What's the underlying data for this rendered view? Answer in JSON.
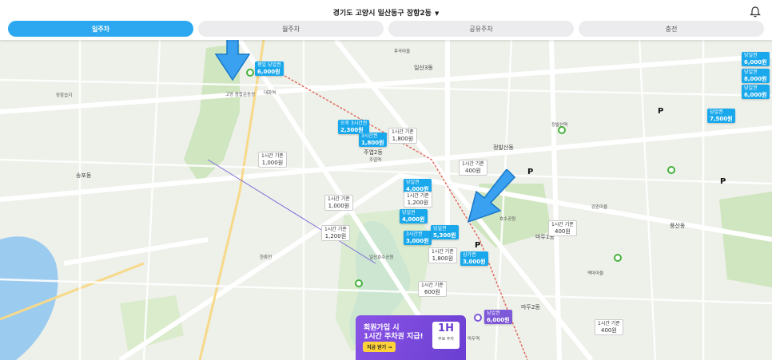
{
  "header": {
    "location": "경기도 고양시 일산동구 장항2동",
    "caret": "▼"
  },
  "tabs": [
    {
      "label": "일주차",
      "active": true
    },
    {
      "label": "월주차",
      "active": false
    },
    {
      "label": "공유주차",
      "active": false
    },
    {
      "label": "충전",
      "active": false
    }
  ],
  "price_labels": [
    {
      "title": "평일 당일권",
      "price": "6,000원"
    },
    {
      "title": "오후 3시간권",
      "price": "2,300원"
    },
    {
      "title": "3시간권",
      "price": "1,800원"
    },
    {
      "title": "당일권",
      "price": "4,000원"
    },
    {
      "title": "당일권",
      "price": "4,000원"
    },
    {
      "title": "3시간권",
      "price": "3,000원"
    },
    {
      "title": "당일권",
      "price": "5,300원"
    },
    {
      "title": "상가권",
      "price": "3,000원"
    },
    {
      "title": "당일권",
      "price": "7,500원"
    },
    {
      "title": "당일권",
      "price": "6,000원"
    },
    {
      "title": "당일권",
      "price": "8,000원"
    },
    {
      "title": "당일권",
      "price": "6,000원"
    }
  ],
  "time_labels": [
    {
      "title": "1시간 기준",
      "price": "1,000원"
    },
    {
      "title": "1시간 기준",
      "price": "1,800원"
    },
    {
      "title": "1시간 기준",
      "price": "400원"
    },
    {
      "title": "1시간 기준",
      "price": "1,000원"
    },
    {
      "title": "1시간 기준",
      "price": "1,200원"
    },
    {
      "title": "1시간 기준",
      "price": "1,800원"
    },
    {
      "title": "1시간 기준",
      "price": "600원"
    },
    {
      "title": "1시간 기준",
      "price": "400원"
    },
    {
      "title": "1시간 기준",
      "price": "400원"
    },
    {
      "title": "1시간 기준",
      "price": "1,200원"
    }
  ],
  "map_labels": [
    "일산3동",
    "주엽2동",
    "정발산동",
    "마두1동",
    "마두2동",
    "풍산동",
    "송포동",
    "한류천",
    "후곡마을",
    "강촌마을",
    "백마마을",
    "대화역",
    "주엽역",
    "정발산역",
    "마두역",
    "고양 종합운동장",
    "호수공원",
    "일산호수공원",
    "장항습지"
  ],
  "banner": {
    "line1": "회원가입 시",
    "line2": "1시간 주차권 지급!",
    "cta": "지금 받기 →",
    "coupon_big": "1H",
    "coupon_small": "무료 주차"
  },
  "icons": [
    "bell-icon",
    "arrow-icon",
    "parking-icon"
  ],
  "colors": {
    "accent": "#2ba8f0",
    "price": "#1aa8ec",
    "purple": "#7d58d9",
    "pin": "#46b23c"
  }
}
